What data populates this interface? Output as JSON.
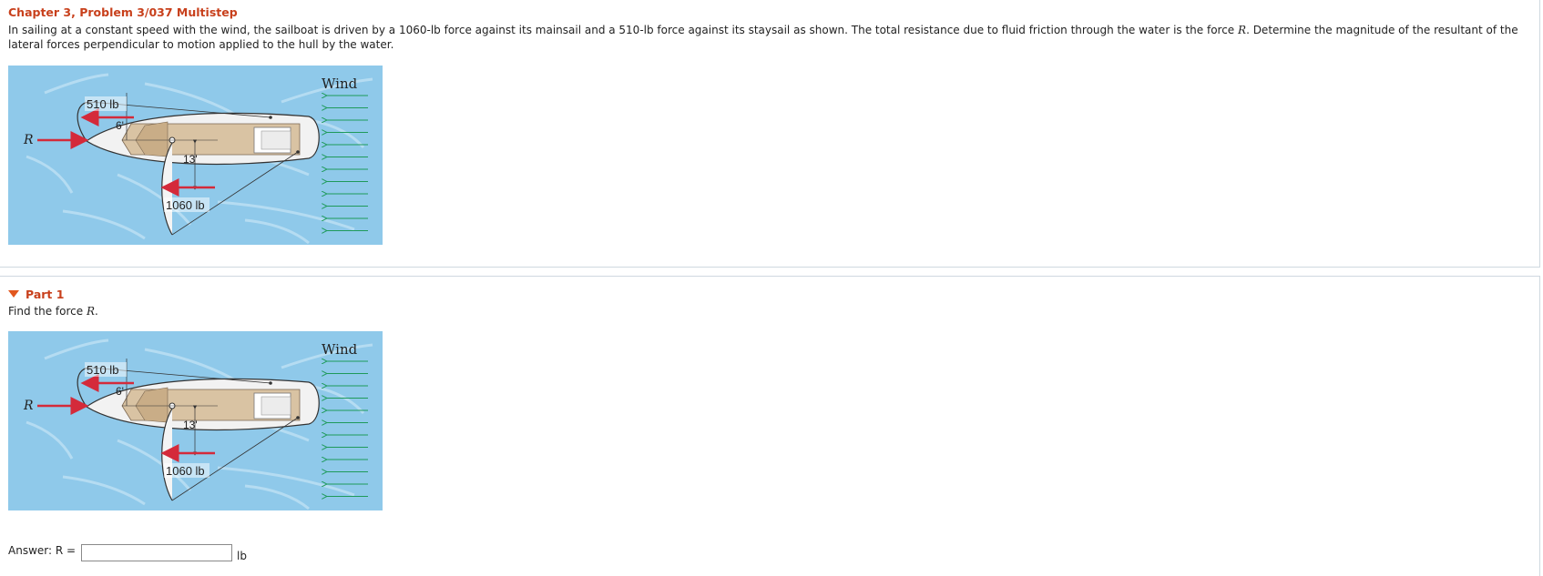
{
  "title": "Chapter 3, Problem 3/037 Multistep",
  "statement_before_R": "In sailing at a constant speed with the wind, the sailboat is driven by a 1060-lb force against its mainsail and a 510-lb force against its staysail as shown. The total resistance due to fluid friction through the water is the force ",
  "statement_R": "R",
  "statement_after_R": ". Determine the magnitude of the resultant of the lateral forces perpendicular to motion applied to the hull by the water.",
  "figure": {
    "wind_label": "Wind",
    "staysail_force": "510 lb",
    "mainsail_force": "1060 lb",
    "dim_6": "6'",
    "dim_13": "13'",
    "resistance_label": "R"
  },
  "part": {
    "label": "Part 1",
    "prompt_before": "Find the force ",
    "prompt_var": "R",
    "prompt_after": "."
  },
  "answer": {
    "label": "Answer: R =",
    "value": "",
    "unit": "lb"
  },
  "colors": {
    "heading": "#c8401c",
    "water": "#8fc9ea",
    "force_arrow": "#d42a3a",
    "wind_arrow": "#1e9a5a"
  }
}
